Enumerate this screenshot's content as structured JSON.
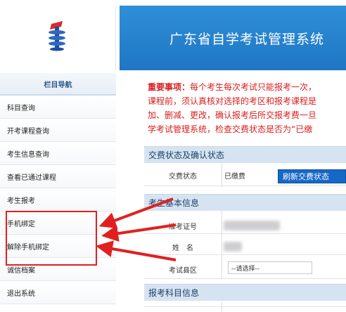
{
  "header": {
    "title": "广东省自学考试管理系统"
  },
  "logo": {
    "icon": "exam-logo-icon"
  },
  "sidebar": {
    "heading": "栏目导航",
    "items": [
      {
        "label": "科目查询"
      },
      {
        "label": "开考课程查询"
      },
      {
        "label": "考生信息查询"
      },
      {
        "label": "查看已通过课程"
      },
      {
        "label": "考生报考"
      },
      {
        "label": "手机绑定"
      },
      {
        "label": "解除手机绑定"
      },
      {
        "label": "诚信档案"
      },
      {
        "label": "退出系统"
      }
    ]
  },
  "notice": {
    "prefix": "重要事项：",
    "line1": "每个考生每次考试只能报考一次，",
    "line2": "课程前，须认真核对选择的考区和报考课程是",
    "line3": "加、删减、更改，确认报考后所交报考费一旦",
    "line4": "学考试管理系统，检查交费状态是否为“已缴"
  },
  "payment_section": {
    "title": "交费状态及确认状态",
    "status_label": "交费状态",
    "status_value": "已缴费",
    "refresh_button": "刷新交费状态"
  },
  "basic_info": {
    "title": "考生基本信息",
    "admission_label": "准考证号",
    "name_label": "姓　名",
    "district_label": "考试县区",
    "district_select": "--请选择--"
  },
  "subjects_section": {
    "title": "报考科目信息"
  },
  "colors": {
    "header_blue": "#2381cf",
    "notice_red": "#d81e1e",
    "highlight_red": "#e02020",
    "button_blue": "#1668c6"
  }
}
